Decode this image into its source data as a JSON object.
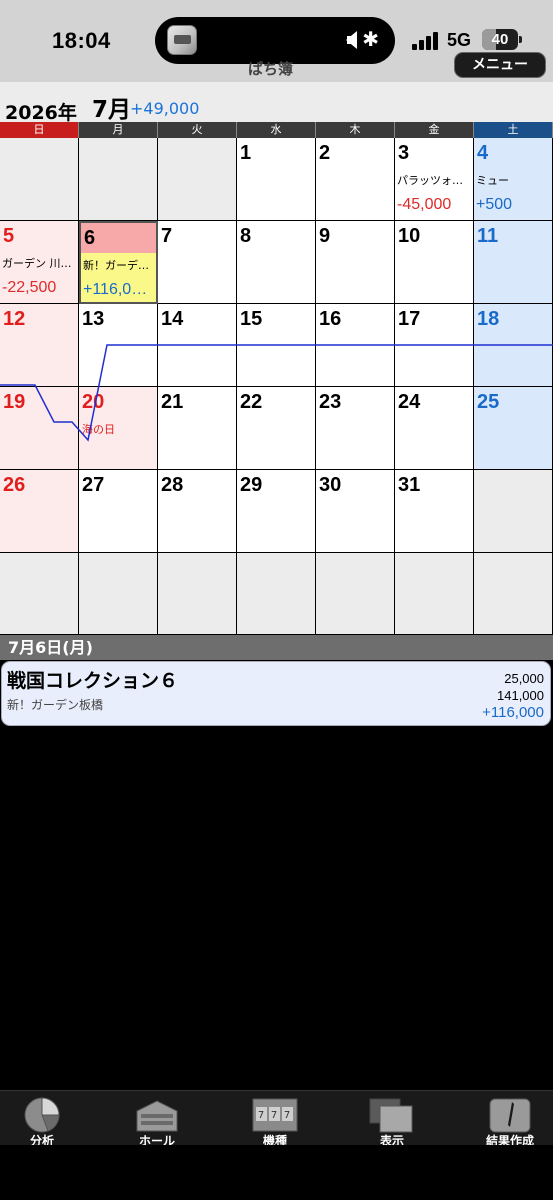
{
  "status": {
    "time": "18:04",
    "network": "5G",
    "battery": "40",
    "battery_level": 0.4
  },
  "app": {
    "title": "ぱち簿",
    "menu_label": "メニュー"
  },
  "calendar": {
    "year": "2026年",
    "month": "7月",
    "month_total": "+49,000",
    "weekdays": [
      "日",
      "月",
      "火",
      "水",
      "木",
      "金",
      "土"
    ],
    "days": {
      "d1": "1",
      "d2": "2",
      "d3": "3",
      "d4": "4",
      "d5": "5",
      "d6": "6",
      "d7": "7",
      "d8": "8",
      "d9": "9",
      "d10": "10",
      "d11": "11",
      "d12": "12",
      "d13": "13",
      "d14": "14",
      "d15": "15",
      "d16": "16",
      "d17": "17",
      "d18": "18",
      "d19": "19",
      "d20": "20",
      "d21": "21",
      "d22": "22",
      "d23": "23",
      "d24": "24",
      "d25": "25",
      "d26": "26",
      "d27": "27",
      "d28": "28",
      "d29": "29",
      "d30": "30",
      "d31": "31"
    },
    "entries": {
      "d3": {
        "text": "パラッツォ…",
        "value": "-45,000"
      },
      "d4": {
        "text": "ミュー",
        "value": "+500"
      },
      "d5": {
        "text": "ガーデン 川…",
        "value": "-22,500"
      },
      "d6": {
        "text": "新！ガーデ…",
        "value": "+116,0…"
      }
    },
    "holidays": {
      "d20": "海の日"
    }
  },
  "detail": {
    "date": "7月6日(月)",
    "title": "戦国コレクション６",
    "store": "新！ガーデン板橋",
    "investment": "25,000",
    "recovery": "141,000",
    "balance": "+116,000"
  },
  "tabs": [
    {
      "label": "分析",
      "icon": "pie-chart-icon"
    },
    {
      "label": "ホール",
      "icon": "building-icon"
    },
    {
      "label": "機種",
      "icon": "slot-machine-icon"
    },
    {
      "label": "表示",
      "icon": "layers-icon"
    },
    {
      "label": "結果作成",
      "icon": "pen-icon"
    }
  ],
  "colors": {
    "sunday": "#e01e1e",
    "saturday": "#1a6ac9",
    "positive": "#1a6ac9",
    "negative": "#e02a2a",
    "selected_cell": "#fbf88a",
    "graph_line": "#1f2fd0"
  }
}
